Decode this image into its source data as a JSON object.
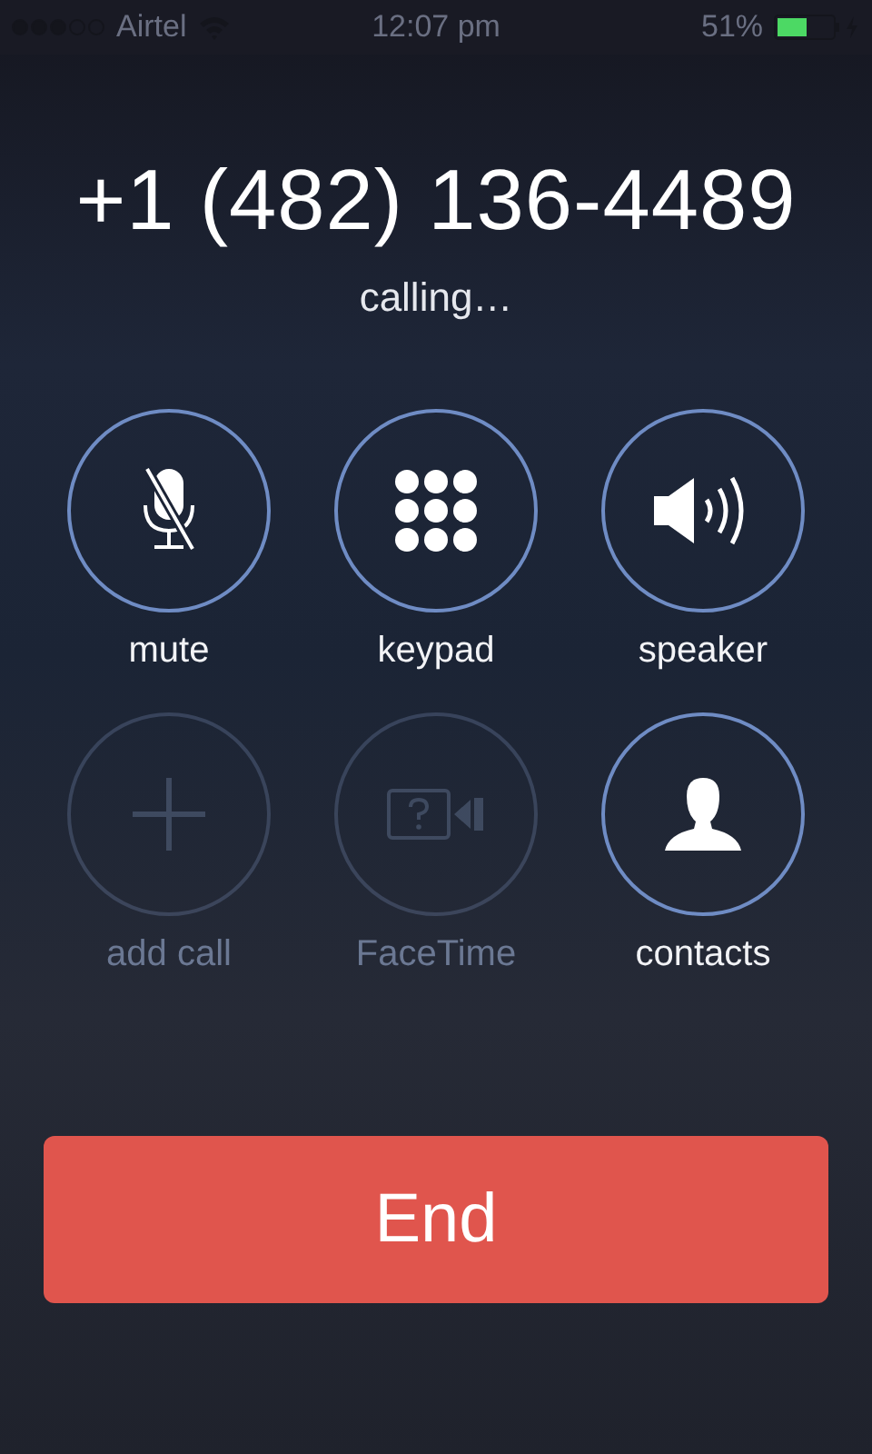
{
  "status_bar": {
    "carrier": "Airtel",
    "time": "12:07 pm",
    "battery": "51%"
  },
  "call": {
    "number": "+1 (482) 136-4489",
    "status": "calling…"
  },
  "buttons": [
    {
      "kind": "mute",
      "label": "mute",
      "disabled": false
    },
    {
      "kind": "keypad",
      "label": "keypad",
      "disabled": false
    },
    {
      "kind": "speaker",
      "label": "speaker",
      "disabled": false
    },
    {
      "kind": "add",
      "label": "add call",
      "disabled": true
    },
    {
      "kind": "facetime",
      "label": "FaceTime",
      "disabled": true
    },
    {
      "kind": "contacts",
      "label": "contacts",
      "disabled": false
    }
  ],
  "end_button": {
    "label": "End"
  }
}
